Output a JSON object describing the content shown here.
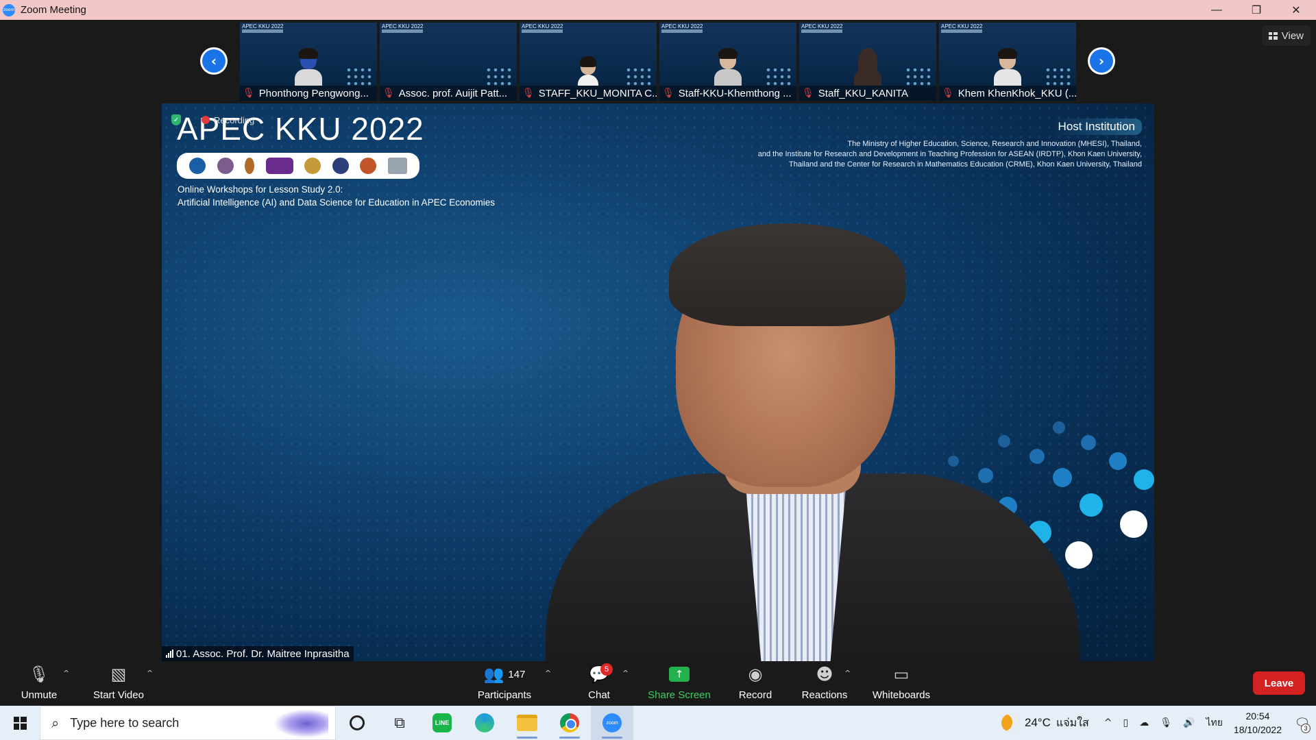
{
  "window": {
    "title": "Zoom Meeting",
    "app_icon_text": "zoom",
    "controls": {
      "minimize": "—",
      "restore": "❐",
      "close": "✕"
    }
  },
  "view_button": {
    "label": "View"
  },
  "gallery": {
    "slide_header": "APEC KKU 2022",
    "prev_arrow": "‹",
    "next_arrow": "›",
    "participants": [
      {
        "name": "Phonthong  Pengwong...",
        "mic_muted": true
      },
      {
        "name": "Assoc. prof. Auijit  Patt...",
        "mic_muted": true
      },
      {
        "name": "STAFF_KKU_MONITA C...",
        "mic_muted": true
      },
      {
        "name": "Staff-KKU-Khemthong ...",
        "mic_muted": true
      },
      {
        "name": "Staff_KKU_KANITA",
        "mic_muted": true
      },
      {
        "name": "Khem KhenKhok_KKU (...",
        "mic_muted": true
      }
    ]
  },
  "main_video": {
    "recording_label": "Recording",
    "slide_title": "APEC KKU 2022",
    "subtitle_line1": "Online Workshops for Lesson Study 2.0:",
    "subtitle_line2": "Artificial Intelligence (AI) and Data Science for Education in APEC Economies",
    "host_title": "Host Institution",
    "host_line1": "The Ministry of Higher Education, Science, Research and Innovation (MHESI), Thailand,",
    "host_line2": "and the Institute for Research and Development in Teaching Profession for ASEAN (IRDTP), Khon Kaen University,",
    "host_line3": "Thailand and the Center for Research in Mathematics Education (CRME), Khon Kaen University, Thailand",
    "speaker_name": "01. Assoc. Prof. Dr. Maitree Inprasitha"
  },
  "toolbar": {
    "unmute": "Unmute",
    "start_video": "Start Video",
    "participants": "Participants",
    "participants_count": "147",
    "chat": "Chat",
    "chat_badge": "5",
    "share_screen": "Share Screen",
    "record": "Record",
    "reactions": "Reactions",
    "whiteboards": "Whiteboards",
    "leave": "Leave"
  },
  "taskbar": {
    "search_placeholder": "Type here to search",
    "line_label": "LINE",
    "zoom_label": "zoom",
    "temperature": "24°C",
    "weather_condition": "แจ่มใส",
    "language": "ไทย",
    "time": "20:54",
    "date": "18/10/2022",
    "notification_count": "3"
  },
  "colors": {
    "title_bar": "#f2c7c7",
    "leave": "#d42121",
    "share_screen": "#22b14c",
    "muted_mic": "#e5403d",
    "zoom_blue": "#2d8cff"
  }
}
